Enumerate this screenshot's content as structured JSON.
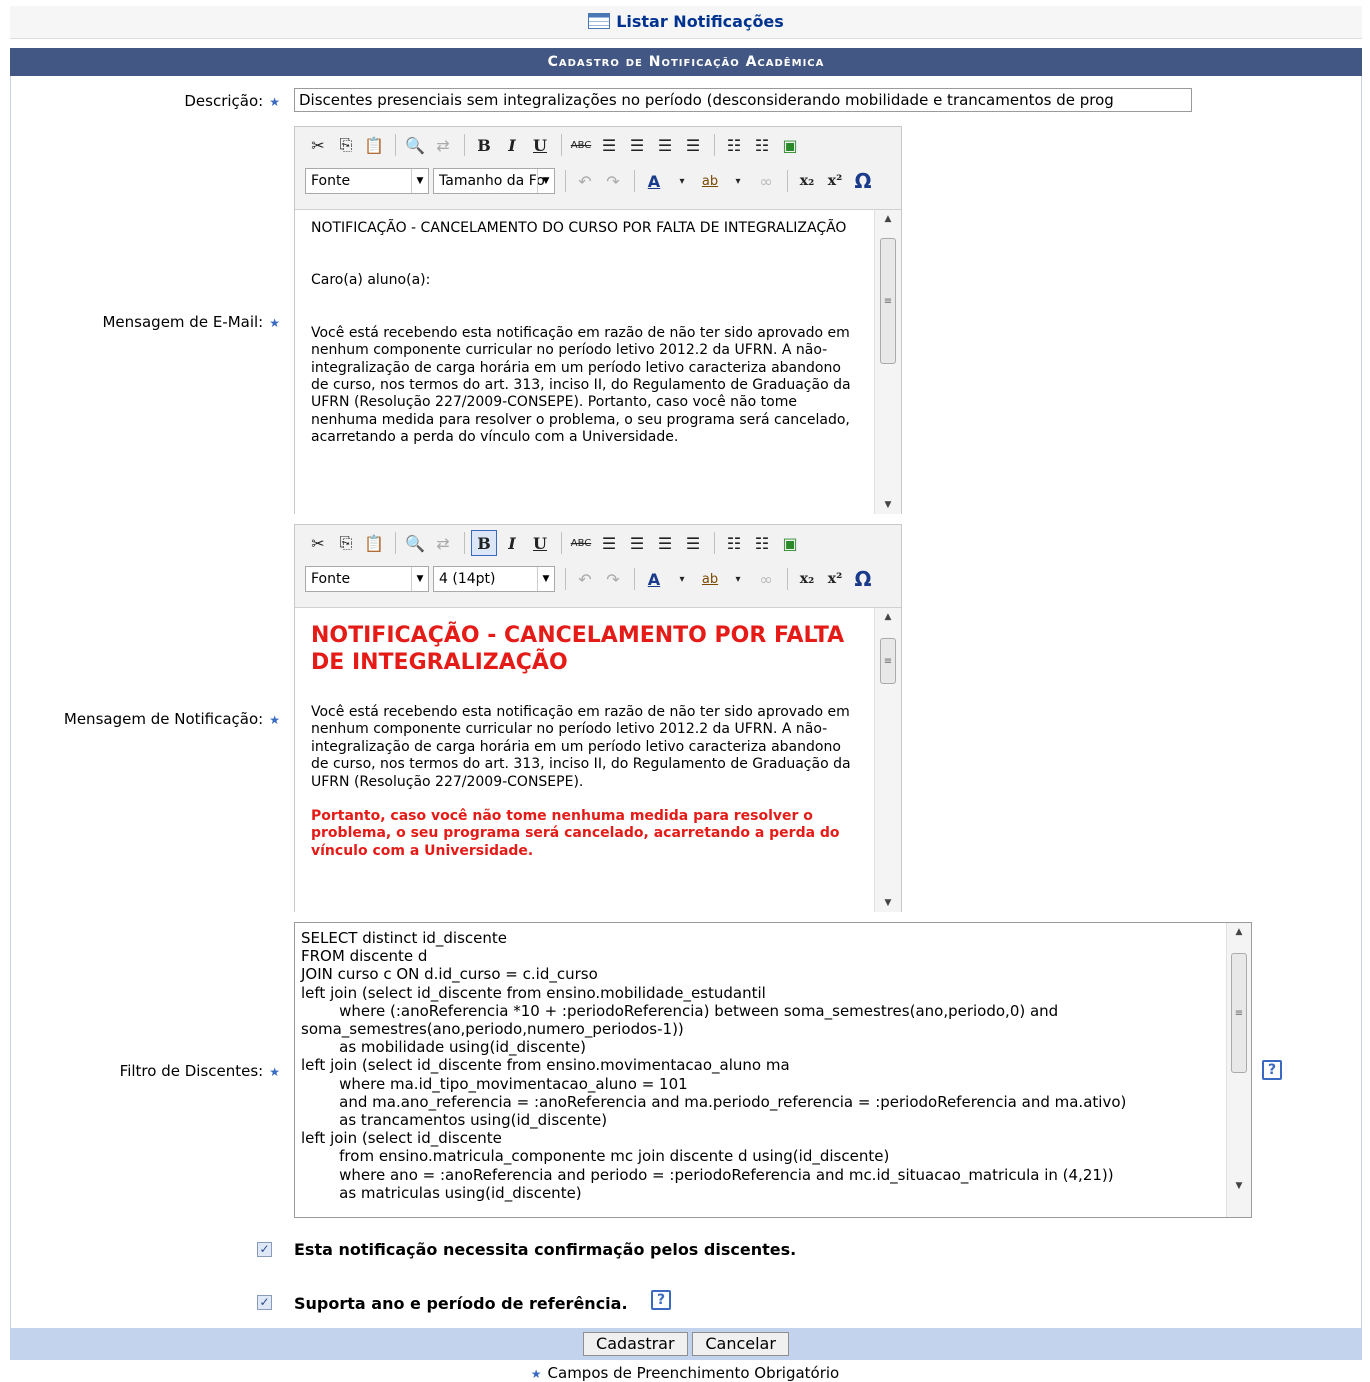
{
  "top_link": {
    "label": "Listar Notificações"
  },
  "form": {
    "caption": "Cadastro de Notificação Acadêmica",
    "description": {
      "label": "Descrição:",
      "value": "Discentes presenciais sem integralizações no período (desconsiderando mobilidade e trancamentos de prog"
    },
    "email": {
      "label": "Mensagem de E-Mail:",
      "font_select": "Fonte",
      "size_select": "Tamanho da Fo",
      "title": "NOTIFICAÇÃO - CANCELAMENTO DO CURSO POR FALTA DE INTEGRALIZAÇÃO",
      "greeting": "Caro(a) aluno(a):",
      "body": "Você está recebendo esta notificação em razão de não ter sido aprovado em nenhum componente curricular no período letivo 2012.2 da UFRN. A não-integralização de carga horária em um período letivo caracteriza abandono de curso, nos termos do art. 313, inciso II, do Regulamento de Graduação da UFRN (Resolução 227/2009-CONSEPE). Portanto, caso você não tome nenhuma medida para resolver o problema, o seu programa será cancelado, acarretando a perda do vínculo com a Universidade."
    },
    "notification": {
      "label": "Mensagem de Notificação:",
      "font_select": "Fonte",
      "size_select": "4 (14pt)",
      "title": "NOTIFICAÇÃO - CANCELAMENTO POR FALTA DE INTEGRALIZAÇÃO",
      "body": "Você está recebendo esta notificação em razão de não ter sido aprovado em nenhum componente curricular no período letivo 2012.2 da UFRN. A não-integralização de carga horária em um período letivo caracteriza abandono de curso, nos termos do art. 313, inciso II, do Regulamento de Graduação da UFRN (Resolução 227/2009-CONSEPE).",
      "warning": "Portanto, caso você não tome nenhuma medida para resolver o problema, o seu programa será cancelado, acarretando a perda do vínculo com a Universidade."
    },
    "filter": {
      "label": "Filtro de Discentes:",
      "sql": "SELECT distinct id_discente\nFROM discente d\nJOIN curso c ON d.id_curso = c.id_curso\nleft join (select id_discente from ensino.mobilidade_estudantil\n        where (:anoReferencia *10 + :periodoReferencia) between soma_semestres(ano,periodo,0) and soma_semestres(ano,periodo,numero_periodos-1))\n        as mobilidade using(id_discente)\nleft join (select id_discente from ensino.movimentacao_aluno ma\n        where ma.id_tipo_movimentacao_aluno = 101\n        and ma.ano_referencia = :anoReferencia and ma.periodo_referencia = :periodoReferencia and ma.ativo)\n        as trancamentos using(id_discente)\nleft join (select id_discente\n        from ensino.matricula_componente mc join discente d using(id_discente)\n        where ano = :anoReferencia and periodo = :periodoReferencia and mc.id_situacao_matricula in (4,21))\n        as matriculas using(id_discente)"
    },
    "confirm_checkbox": {
      "label": "Esta notificação necessita confirmação pelos discentes.",
      "checked": true
    },
    "reference_checkbox": {
      "label": "Suporta ano e período de referência.",
      "checked": true
    },
    "buttons": {
      "submit": "Cadastrar",
      "cancel": "Cancelar"
    },
    "required_note": "Campos de Preenchimento Obrigatório",
    "help_glyph": "?",
    "required_glyph": "★"
  },
  "colors": {
    "caption_bg": "#435784",
    "footer_bg": "#c3d3ee",
    "link": "#003390",
    "red_text": "#e41b17"
  }
}
